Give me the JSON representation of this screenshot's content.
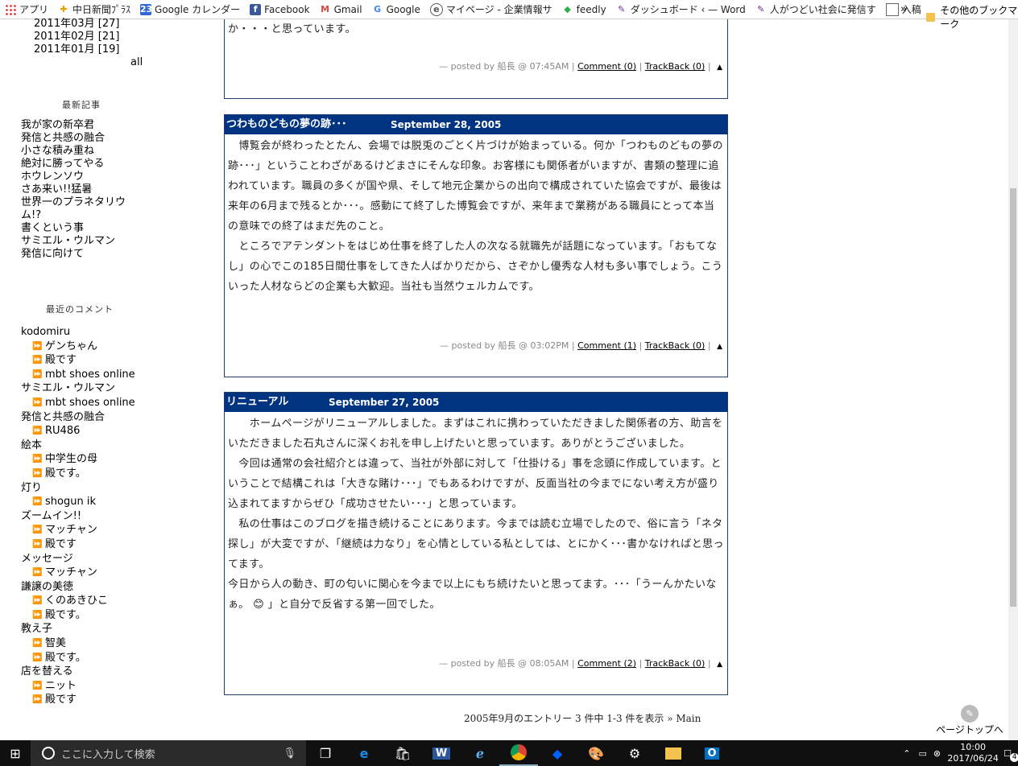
{
  "bookmarks": {
    "items": [
      {
        "label": "アプリ",
        "icon": "apps-icon"
      },
      {
        "label": "中日新聞ﾌﾟﾗｽ",
        "icon": "plus-icon"
      },
      {
        "label": "Google カレンダー",
        "icon": "google-calendar-icon",
        "icon_text": "23"
      },
      {
        "label": "Facebook",
        "icon": "facebook-icon",
        "icon_text": "f"
      },
      {
        "label": "Gmail",
        "icon": "gmail-icon",
        "icon_text": "M"
      },
      {
        "label": "Google",
        "icon": "google-icon",
        "icon_text": "G"
      },
      {
        "label": "マイページ - 企業情報サ",
        "icon": "mypage-icon"
      },
      {
        "label": "feedly",
        "icon": "feedly-icon"
      },
      {
        "label": "ダッシュボード ‹ — Word",
        "icon": "wordpress-icon"
      },
      {
        "label": "人がつどい社会に発信す",
        "icon": "wordpress-icon"
      },
      {
        "label": "入稿",
        "icon": "document-icon"
      }
    ],
    "more": "»",
    "other": "その他のブックマーク"
  },
  "sidebar": {
    "archives": [
      "2011年03月 [27]",
      "2011年02月 [21]",
      "2011年01月 [19]"
    ],
    "archives_all": "all",
    "recent_heading": "最新記事",
    "recent": [
      "我が家の新卒君",
      "発信と共感の融合",
      "小さな積み重ね",
      "絶対に勝ってやる",
      "ホウレンソウ",
      "さあ来い!!猛暑",
      "世界一のプラネタリウ",
      "ム!?",
      "書くという事",
      "サミエル・ウルマン",
      "発信に向けて"
    ],
    "comments_heading": "最近のコメント",
    "comments": [
      {
        "title": "kodomiru",
        "items": [
          "ゲンちゃん",
          "殿です",
          "mbt shoes online"
        ]
      },
      {
        "title": "サミエル・ウルマン",
        "items": [
          "mbt shoes online"
        ]
      },
      {
        "title": "発信と共感の融合",
        "items": [
          "RU486"
        ]
      },
      {
        "title": "絵本",
        "items": [
          "中学生の母",
          "殿です。"
        ]
      },
      {
        "title": "灯り",
        "items": [
          "shogun ik"
        ]
      },
      {
        "title": "ズームイン!!",
        "items": [
          "マッチャン",
          "殿です"
        ]
      },
      {
        "title": "メッセージ",
        "items": [
          "マッチャン"
        ]
      },
      {
        "title": "謙譲の美徳",
        "items": [
          "くのあきひこ",
          "殿です。"
        ]
      },
      {
        "title": "教え子",
        "items": [
          "智美",
          "殿です。"
        ]
      },
      {
        "title": "店を替える",
        "items": [
          "ニット",
          "殿です"
        ]
      }
    ]
  },
  "posts": [
    {
      "title": "",
      "date": "",
      "paragraphs": [
        "か・・・と思っています。"
      ],
      "footer": {
        "posted": "— posted by 船長 @ 07:45AM |",
        "comment": "Comment (0)",
        "sep": "|",
        "trackback": "TrackBack (0)",
        "end": "|"
      }
    },
    {
      "title": "つわものどもの夢の跡･･･",
      "date": "September 28, 2005",
      "paragraphs": [
        "　博覧会が終わったとたん、会場では脱兎のごとく片づけが始まっている。何か「つわものどもの夢の跡･･･」ということわざがあるけどまさにそんな印象。お客様にも関係者がいますが、書類の整理に追われています。職員の多くが国や県、そして地元企業からの出向で構成されていた協会ですが、最後は来年の6月まで残るとか･･･。感動にて終了した博覧会ですが、来年まで業務がある職員にとって本当の意味での終了はまだ先のこと。",
        "　ところでアテンダントをはじめ仕事を終了した人の次なる就職先が話題になっています。「おもてなし」の心でこの185日間仕事をしてきた人ばかりだから、さぞかし優秀な人材も多い事でしょう。こういった人材ならどの企業も大歓迎。当社も当然ウェルカムです。"
      ],
      "footer": {
        "posted": "— posted by 船長 @ 03:02PM |",
        "comment": "Comment (1)",
        "sep": "|",
        "trackback": "TrackBack (0)",
        "end": "|"
      }
    },
    {
      "title": "リニューアル",
      "date": "September 27, 2005",
      "paragraphs": [
        "　　ホームページがリニューアルしました。まずはこれに携わっていただきました関係者の方、助言をいただきました石丸さんに深くお礼を申し上げたいと思っています。ありがとうございました。",
        "　今回は通常の会社紹介とは違って、当社が外部に対して「仕掛ける」事を念頭に作成しています。ということで結構これは「大きな賭け･･･」でもあるわけですが、反面当社の今までにない考え方が盛り込まれてますからぜひ「成功させたい･･･」と思っています。",
        "　私の仕事はこのブログを描き続けることにあります。今までは読む立場でしたので、俗に言う「ネタ探し」が大変ですが、「継続は力なり」を心情としている私としては、とにかく･･･書かなければと思ってます。",
        "今日から人の動き、町の匂いに関心を今まで以上にもち続けたいと思ってます。･･･「うーんかたいなぁ。 😊 」と自分で反省する第一回でした。"
      ],
      "footer": {
        "posted": "— posted by 船長 @ 08:05AM |",
        "comment": "Comment (2)",
        "sep": "|",
        "trackback": "TrackBack (0)",
        "end": "|"
      }
    }
  ],
  "entry_nav": "2005年9月のエントリー 3 件中 1-3 件を表示 » Main",
  "page_top": "ページトップへ",
  "taskbar": {
    "search_placeholder": "ここに入力して検索",
    "time": "10:00",
    "date": "2017/06/24",
    "notification_count": "4"
  },
  "colors": {
    "post_header": "#003380",
    "accent": "#1a3a8a"
  }
}
